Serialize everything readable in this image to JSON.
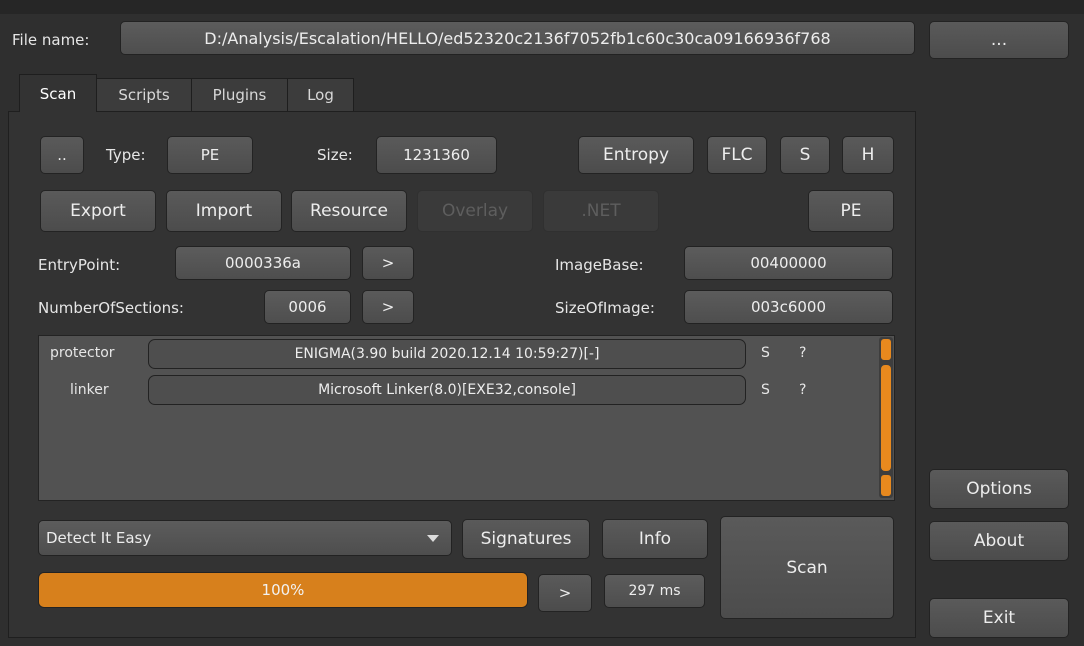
{
  "file": {
    "label": "File name:",
    "path": "D:/Analysis/Escalation/HELLO/ed52320c2136f7052fb1c60c30ca09166936f768",
    "browse_label": "..."
  },
  "tabs": [
    {
      "label": "Scan"
    },
    {
      "label": "Scripts"
    },
    {
      "label": "Plugins"
    },
    {
      "label": "Log"
    }
  ],
  "row1": {
    "dots_label": "..",
    "type_label": "Type:",
    "type_value": "PE",
    "size_label": "Size:",
    "size_value": "1231360",
    "entropy_label": "Entropy",
    "flc_label": "FLC",
    "s_label": "S",
    "h_label": "H"
  },
  "row2": {
    "export_label": "Export",
    "import_label": "Import",
    "resource_label": "Resource",
    "overlay_label": "Overlay",
    "net_label": ".NET",
    "pe_label": "PE"
  },
  "pe_info": {
    "entrypoint_label": "EntryPoint:",
    "entrypoint_value": "0000336a",
    "go_label": ">",
    "imagebase_label": "ImageBase:",
    "imagebase_value": "00400000",
    "sections_label": "NumberOfSections:",
    "sections_value": "0006",
    "sizeofimage_label": "SizeOfImage:",
    "sizeofimage_value": "003c6000"
  },
  "detections": [
    {
      "kind": "protector",
      "value": "ENIGMA(3.90 build 2020.12.14 10:59:27)[-]",
      "s": "S",
      "q": "?"
    },
    {
      "kind": "linker",
      "value": "Microsoft Linker(8.0)[EXE32,console]",
      "s": "S",
      "q": "?"
    }
  ],
  "bottom": {
    "engine_selected": "Detect It Easy",
    "signatures_label": "Signatures",
    "info_label": "Info",
    "scan_label": "Scan",
    "progress_text": "100%",
    "progress_value": 100,
    "go_label": ">",
    "time_text": "297 ms"
  },
  "side": {
    "options_label": "Options",
    "about_label": "About",
    "exit_label": "Exit"
  },
  "colors": {
    "background": "#2f2f2f",
    "progress_fill": "#d7801c",
    "scrollbar": "#e8891e"
  }
}
